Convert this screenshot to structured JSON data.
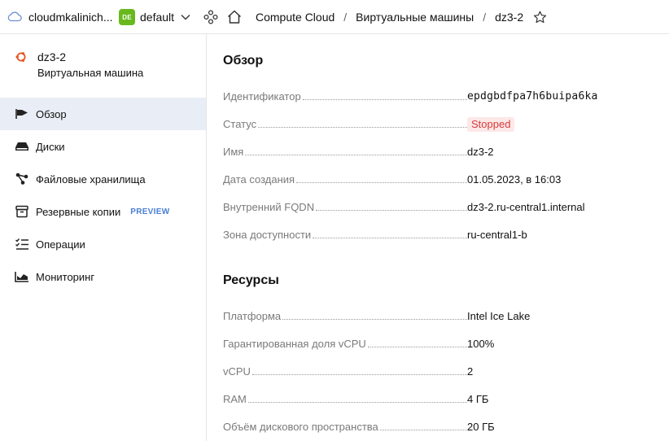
{
  "topbar": {
    "cloud_name": "cloudmkalinich...",
    "folder_badge": "DE",
    "folder_name": "default",
    "breadcrumbs": [
      "Compute Cloud",
      "Виртуальные машины",
      "dz3-2"
    ],
    "separator": "/"
  },
  "sidebar": {
    "vm_name": "dz3-2",
    "vm_type": "Виртуальная машина",
    "items": [
      {
        "label": "Обзор",
        "icon": "flag-icon",
        "active": true
      },
      {
        "label": "Диски",
        "icon": "disk-icon"
      },
      {
        "label": "Файловые хранилища",
        "icon": "file-storage-icon"
      },
      {
        "label": "Резервные копии",
        "icon": "archive-icon",
        "badge": "PREVIEW"
      },
      {
        "label": "Операции",
        "icon": "list-icon"
      },
      {
        "label": "Мониторинг",
        "icon": "chart-icon"
      }
    ]
  },
  "overview": {
    "title": "Обзор",
    "rows": [
      {
        "key": "Идентификатор",
        "value": "epdgbdfpa7h6buipa6ka"
      },
      {
        "key": "Статус",
        "value": "Stopped"
      },
      {
        "key": "Имя",
        "value": "dz3-2"
      },
      {
        "key": "Дата создания",
        "value": "01.05.2023, в 16:03"
      },
      {
        "key": "Внутренний FQDN",
        "value": "dz3-2.ru-central1.internal"
      },
      {
        "key": "Зона доступности",
        "value": "ru-central1-b"
      }
    ]
  },
  "resources": {
    "title": "Ресурсы",
    "rows": [
      {
        "key": "Платформа",
        "value": "Intel Ice Lake"
      },
      {
        "key": "Гарантированная доля vCPU",
        "value": "100%"
      },
      {
        "key": "vCPU",
        "value": "2"
      },
      {
        "key": "RAM",
        "value": "4 ГБ"
      },
      {
        "key": "Объём дискового пространства",
        "value": "20 ГБ"
      }
    ]
  },
  "colors": {
    "folder_badge": "#69b91e",
    "active_nav": "#e9edf5",
    "status_text": "#d83b3b",
    "status_bg": "#fde8e8",
    "ubuntu": "#e95420",
    "preview": "#4a7fd1"
  }
}
